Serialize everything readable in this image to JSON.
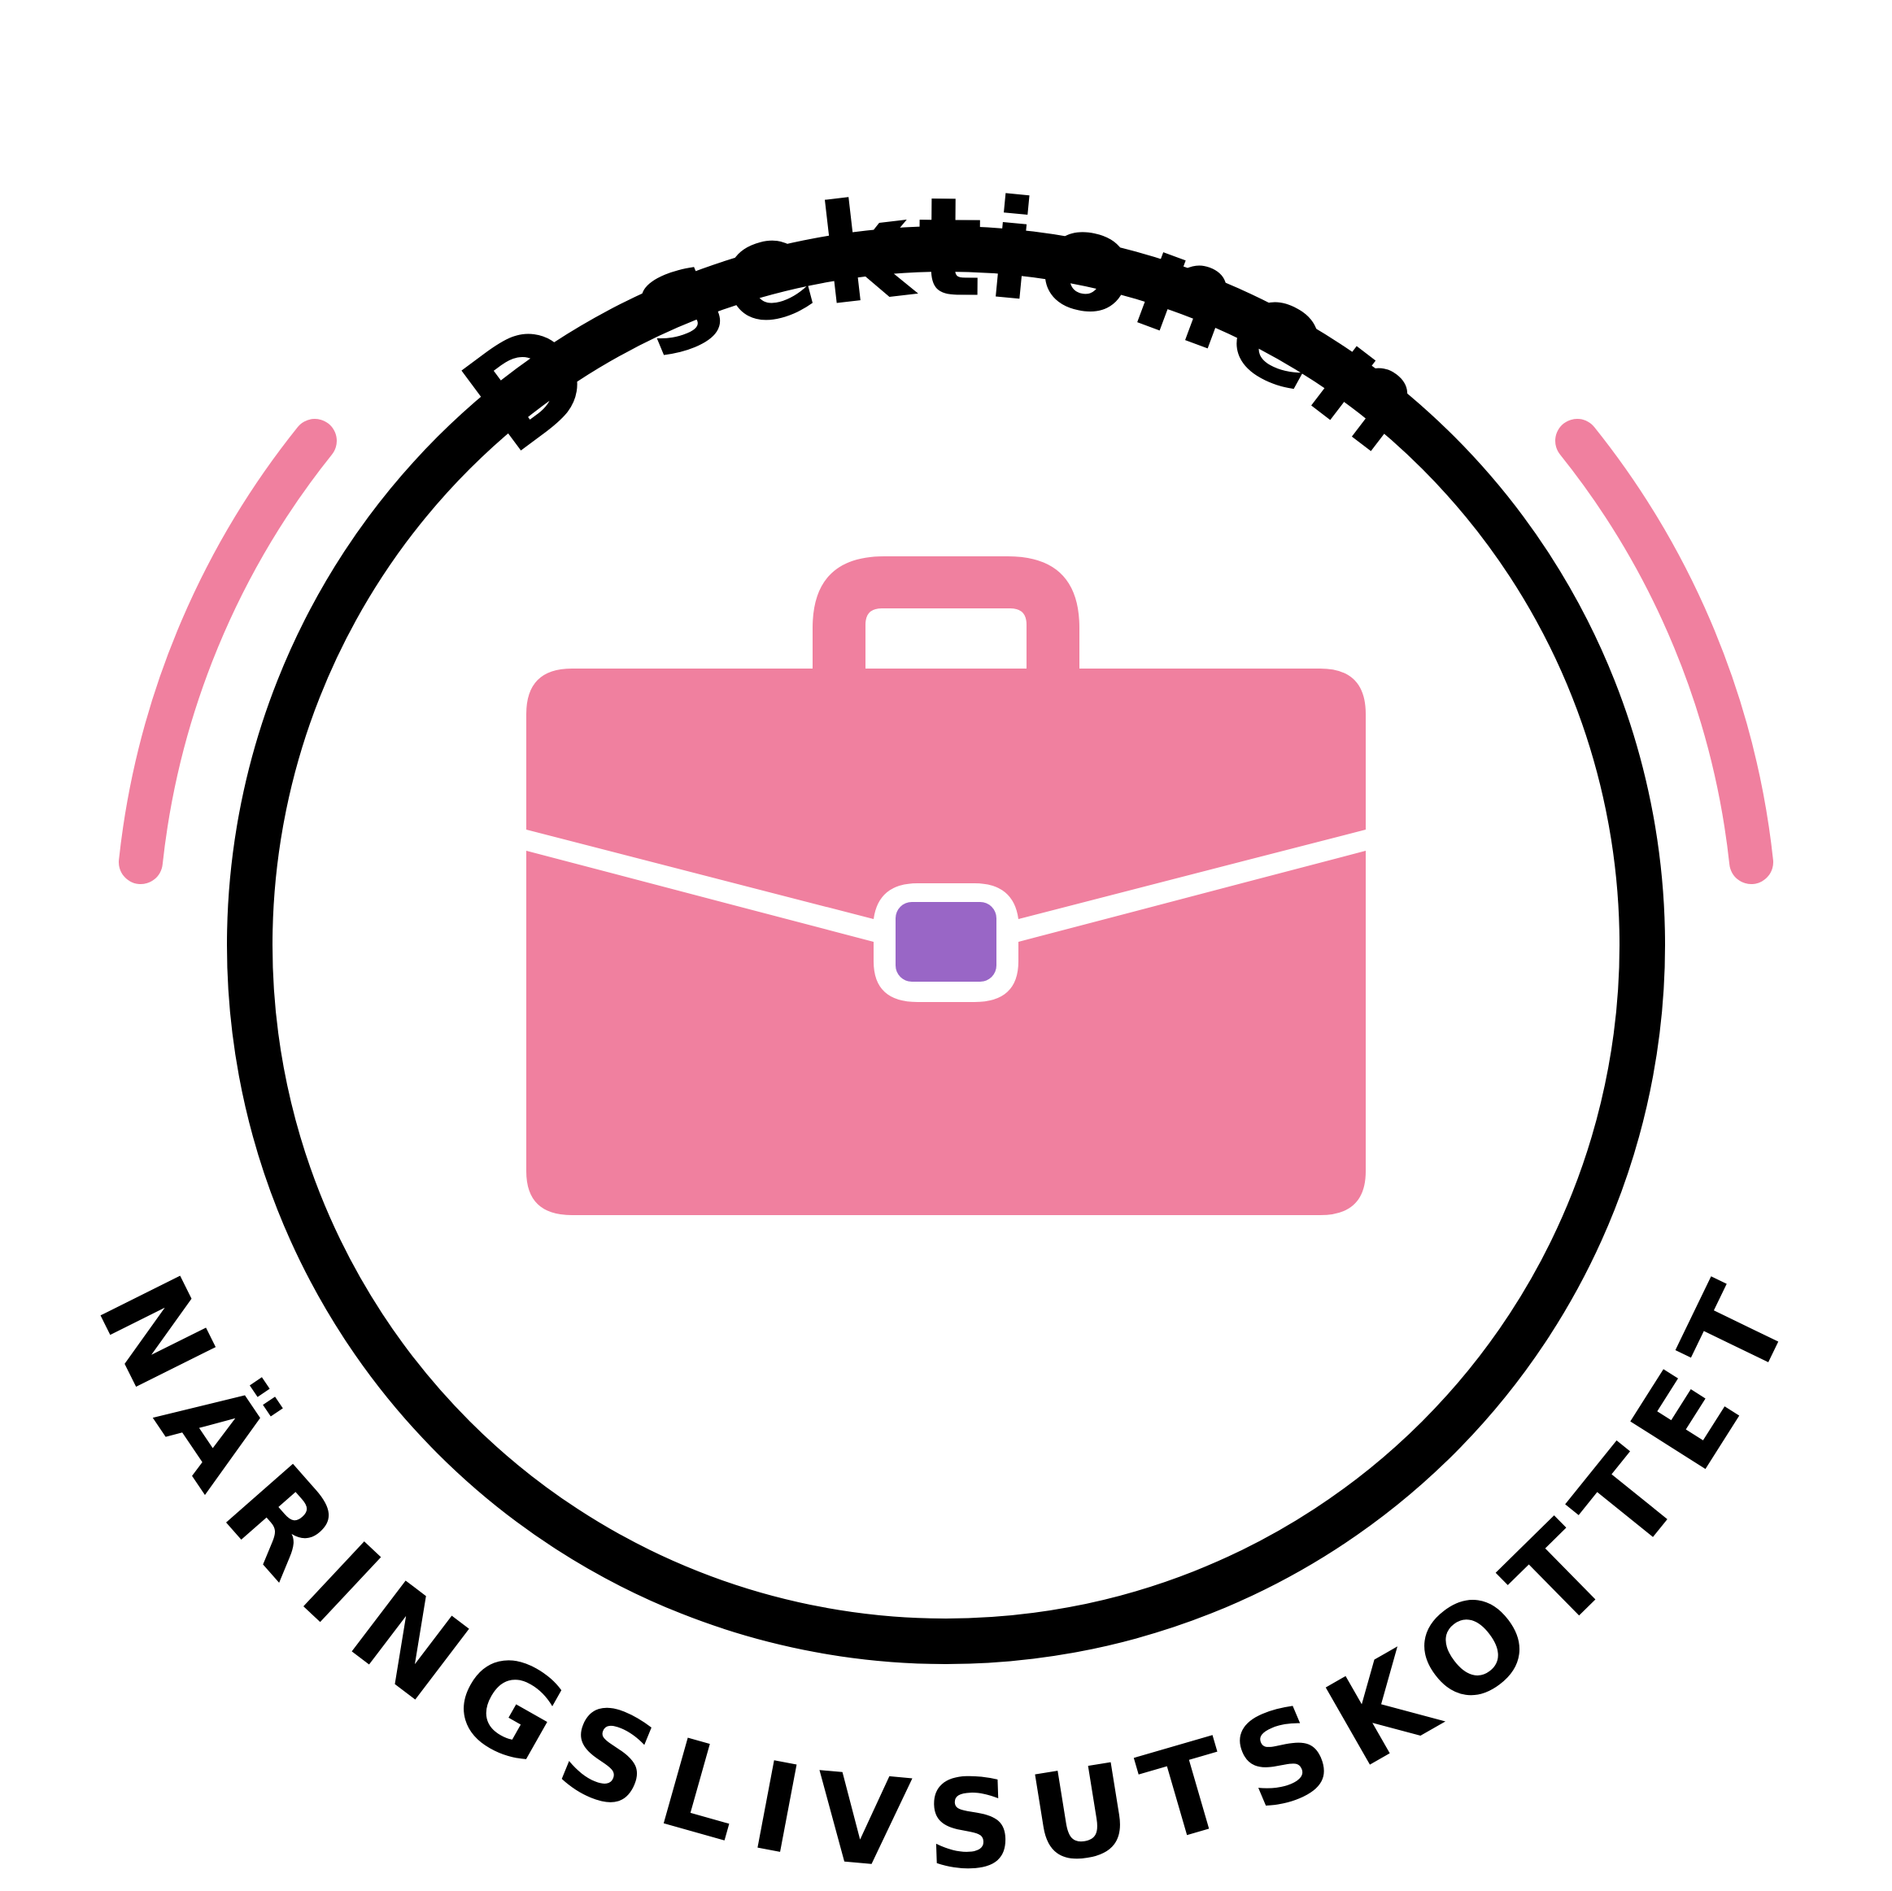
{
  "emblem": {
    "top_text": "D-sektionen",
    "bottom_text": "NÄRINGSLIVSUTSKOTTET",
    "icon": "briefcase-icon",
    "colors": {
      "ring": "#000000",
      "accent_pink": "#F0809F",
      "clasp_purple": "#9966C6",
      "background": "#FFFFFF"
    }
  }
}
